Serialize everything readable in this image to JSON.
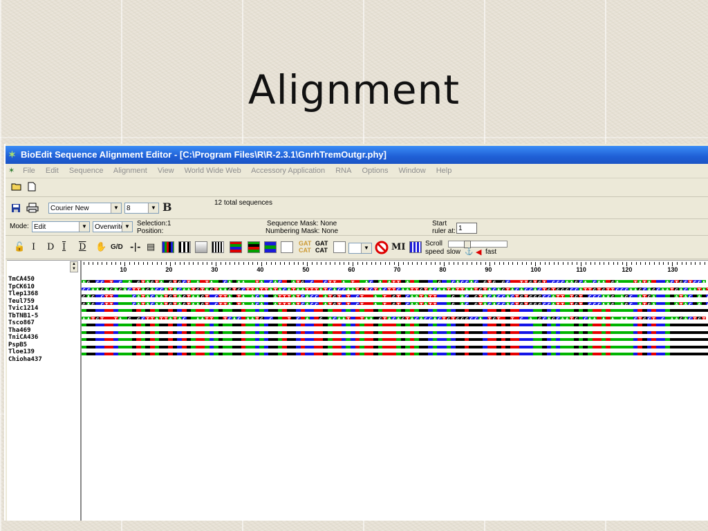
{
  "slide": {
    "title": "Alignment"
  },
  "window": {
    "title": "BioEdit Sequence Alignment Editor - [C:\\Program Files\\R\\R-2.3.1\\GnrhTremOutgr.phy]"
  },
  "menu": [
    "File",
    "Edit",
    "Sequence",
    "Alignment",
    "View",
    "World Wide Web",
    "Accessory Application",
    "RNA",
    "Options",
    "Window",
    "Help"
  ],
  "font_bar": {
    "font_name": "Courier New",
    "font_size": "8",
    "bold_label": "B",
    "total_sequences": "12 total sequences"
  },
  "status_bar": {
    "mode_label": "Mode:",
    "mode_value": "Edit",
    "overwrite_value": "Overwrite",
    "selection_text": "Selection:1",
    "position_text": "Position:",
    "sequence_mask": "Sequence Mask: None",
    "numbering_mask": "Numbering Mask: None",
    "start_label": "Start",
    "ruler_at_label": "ruler at:",
    "ruler_at_value": "1"
  },
  "tool_bar": {
    "i_label": "I",
    "d_label": "D",
    "gd_label": "G/D",
    "mi_label": "MI",
    "scroll_label": "Scroll",
    "speed_label": "speed",
    "slow_label": "slow",
    "fast_label": "fast",
    "gat_top": "GAT",
    "cat_bottom": "CAT"
  },
  "sequence_names": [
    "TmCA450",
    "TpCK610",
    "Tlep1368",
    "Teul759",
    "Tvic1214",
    "TbTNB1-5",
    "Tsco867",
    "Tha469",
    "TniCA436",
    "PspB5",
    "Tloe139",
    "Chioha437"
  ],
  "ruler": {
    "labels": [
      "10",
      "20",
      "30",
      "40",
      "50",
      "60",
      "70",
      "80",
      "90",
      "100",
      "110",
      "120",
      "130"
    ]
  },
  "alignment": {
    "colors": {
      "A": "#00b400",
      "C": "#1414e6",
      "G": "#000000",
      "T": "#e60000"
    },
    "rows": [
      "AG.CC.T.C.A.GTAGTA.GTGCT.A.TA..CA.AA..TA.CAC..ATG.C..CTT.A.T..AC.A.ATT.A......G..CACCAC.GTG.GC..TTGTGT.CCCAAGCA.CAA.GA...TATA...ACTGCTCCA",
      "CCAAGAGAGACTTAGACCATACAATGTAGTAAGTGCTTATTATACATAATTTATCACCAATGTCTACTTCAATTGTACAATATTAATGTACAGTACACCACTGTGGGCCATTGTGTTCCCAAGCAGCAATGACAATATT",
      "GAG.CTT....CATACAATGTAGTAAGT.CTTA.TA.ACA..ATTTATCACC.ATGT.T.CT..A.T.GT.CAATATT...G.AC.GTACACCACTGTGGGCCATT.TGT.CCCAAG.AGC.ATGA....ATAC.A.C",
      "GAG.CTT....CATACAATGTAGTAAGT.CTTA.TA.ACA..ATTTATCACC.ATGT.T.CT..A.T.GT.CAATATT...G.AC.GTACACCACTGTGGGCCATT.TGT.CCCAAG.AGC.ATGA....ATAC.A.C",
      "..................................................................................................................................................",
      "AATGT..TA.G.GCTTATTATAC..AATT..TCAC.AATG.C...T.C.A..G.ACAAT..TAA.GTACAGTACACCACTGTGGGCCA.TGT..T.C.A.GCAGCAATG.CAA.A.A.AA.CTGCT.C.AAGACTGT",
      "..................................................................................................................................................",
      "..................................................................................................................................................",
      "..................................................................................................................................................",
      "..................................................................................................................................................",
      "..................................................................................................................................................",
      ".................................................................................................................................................."
    ],
    "template_row": "AGGCCTTCAAAGTAGTAGGTGCTGATTACAGAAGGTAACACGGATGGCTCCTTGATTCACTATTGATTTAGATAGGCACCACGGTGGGCTTGTGTTCCCAAGCACAAAGAGATTATAAAAACTGCTCCA"
  }
}
